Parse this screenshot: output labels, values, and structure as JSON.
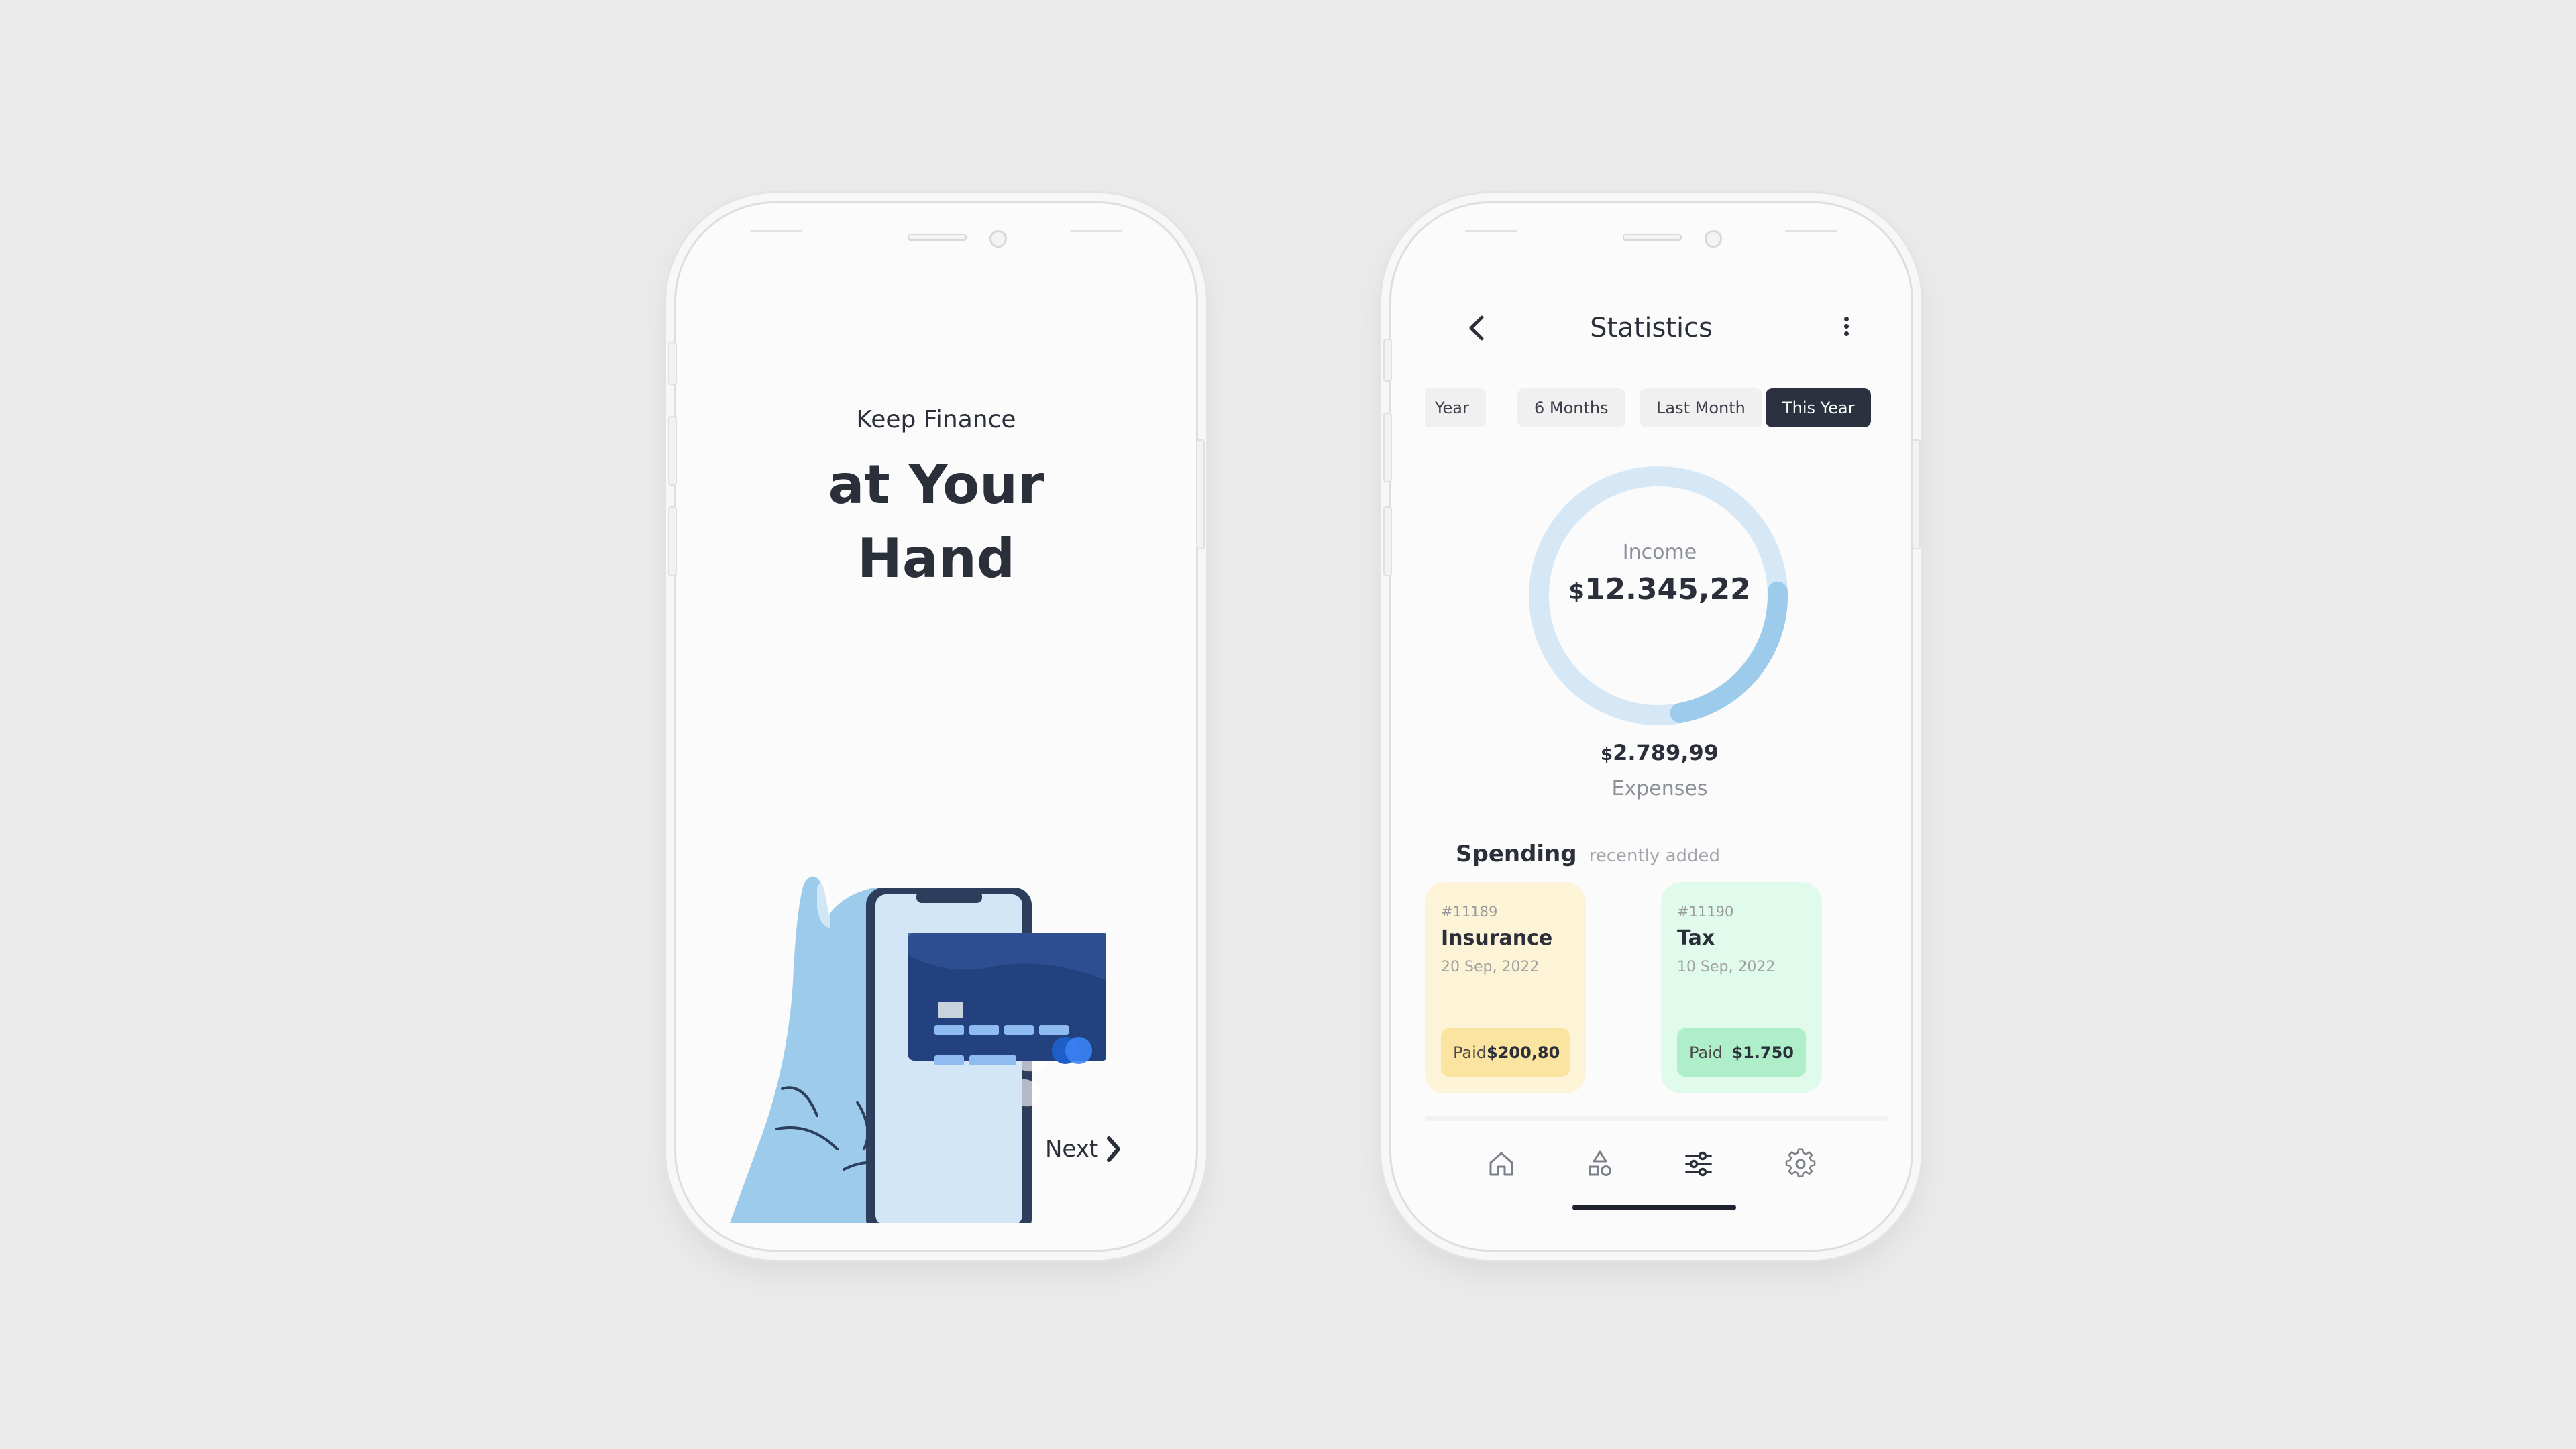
{
  "onboarding": {
    "kicker": "Keep Finance",
    "headline_line1": "at Your",
    "headline_line2": "Hand",
    "next_label": "Next"
  },
  "statistics": {
    "title": "Statistics",
    "tabs": [
      {
        "label": "Year",
        "active": false
      },
      {
        "label": "6 Months",
        "active": false
      },
      {
        "label": "Last Month",
        "active": false
      },
      {
        "label": "This Year",
        "active": true
      }
    ],
    "income": {
      "label": "Income",
      "currency": "$",
      "amount": "12.345,22"
    },
    "expenses": {
      "label": "Expenses",
      "currency": "$",
      "amount": "2.789,99"
    },
    "donut": {
      "expense_share": 0.226,
      "track_color": "#d6e8f6",
      "fill_color": "#9ccbeb"
    },
    "spending": {
      "title": "Spending",
      "subtitle": "recently added",
      "cards": [
        {
          "id": "#11189",
          "name": "Insurance",
          "date": "20 Sep, 2022",
          "status": "Paid",
          "amount": "$200,80",
          "bg": "#fdf4d8",
          "foot_bg": "#fbe3a0"
        },
        {
          "id": "#11190",
          "name": "Tax",
          "date": "10 Sep, 2022",
          "status": "Paid",
          "amount": "$1.750",
          "bg": "#e0faec",
          "foot_bg": "#aeeec8"
        }
      ]
    },
    "nav": [
      {
        "icon": "home-icon",
        "active": false
      },
      {
        "icon": "shapes-icon",
        "active": false
      },
      {
        "icon": "sliders-icon",
        "active": true
      },
      {
        "icon": "gear-icon",
        "active": false
      }
    ]
  }
}
